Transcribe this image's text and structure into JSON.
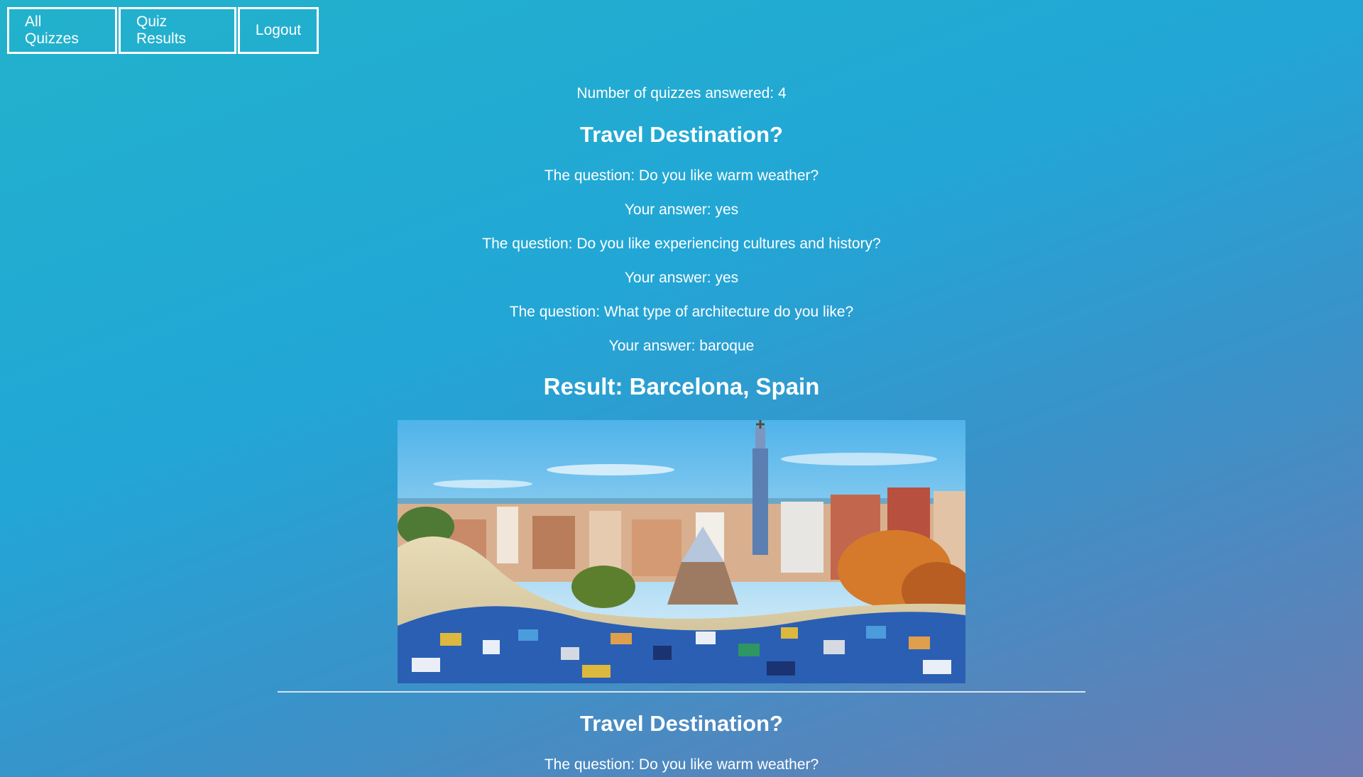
{
  "nav": {
    "items": [
      "All Quizzes",
      "Quiz Results",
      "Logout"
    ]
  },
  "summary": {
    "count_text": "Number of quizzes answered: 4"
  },
  "results": [
    {
      "title": "Travel Destination?",
      "qa": [
        {
          "question": "The question: Do you like warm weather?",
          "answer": "Your answer: yes"
        },
        {
          "question": "The question: Do you like experiencing cultures and history?",
          "answer": "Your answer: yes"
        },
        {
          "question": "The question: What type of architecture do you like?",
          "answer": "Your answer: baroque"
        }
      ],
      "result_text": "Result: Barcelona, Spain",
      "image": "barcelona-park-guell-photo"
    },
    {
      "title": "Travel Destination?",
      "qa": [
        {
          "question": "The question: Do you like warm weather?"
        }
      ]
    }
  ],
  "colors": {
    "background_start": "#22b2cc",
    "background_end": "#6c7bb2",
    "text": "#ffffff"
  }
}
